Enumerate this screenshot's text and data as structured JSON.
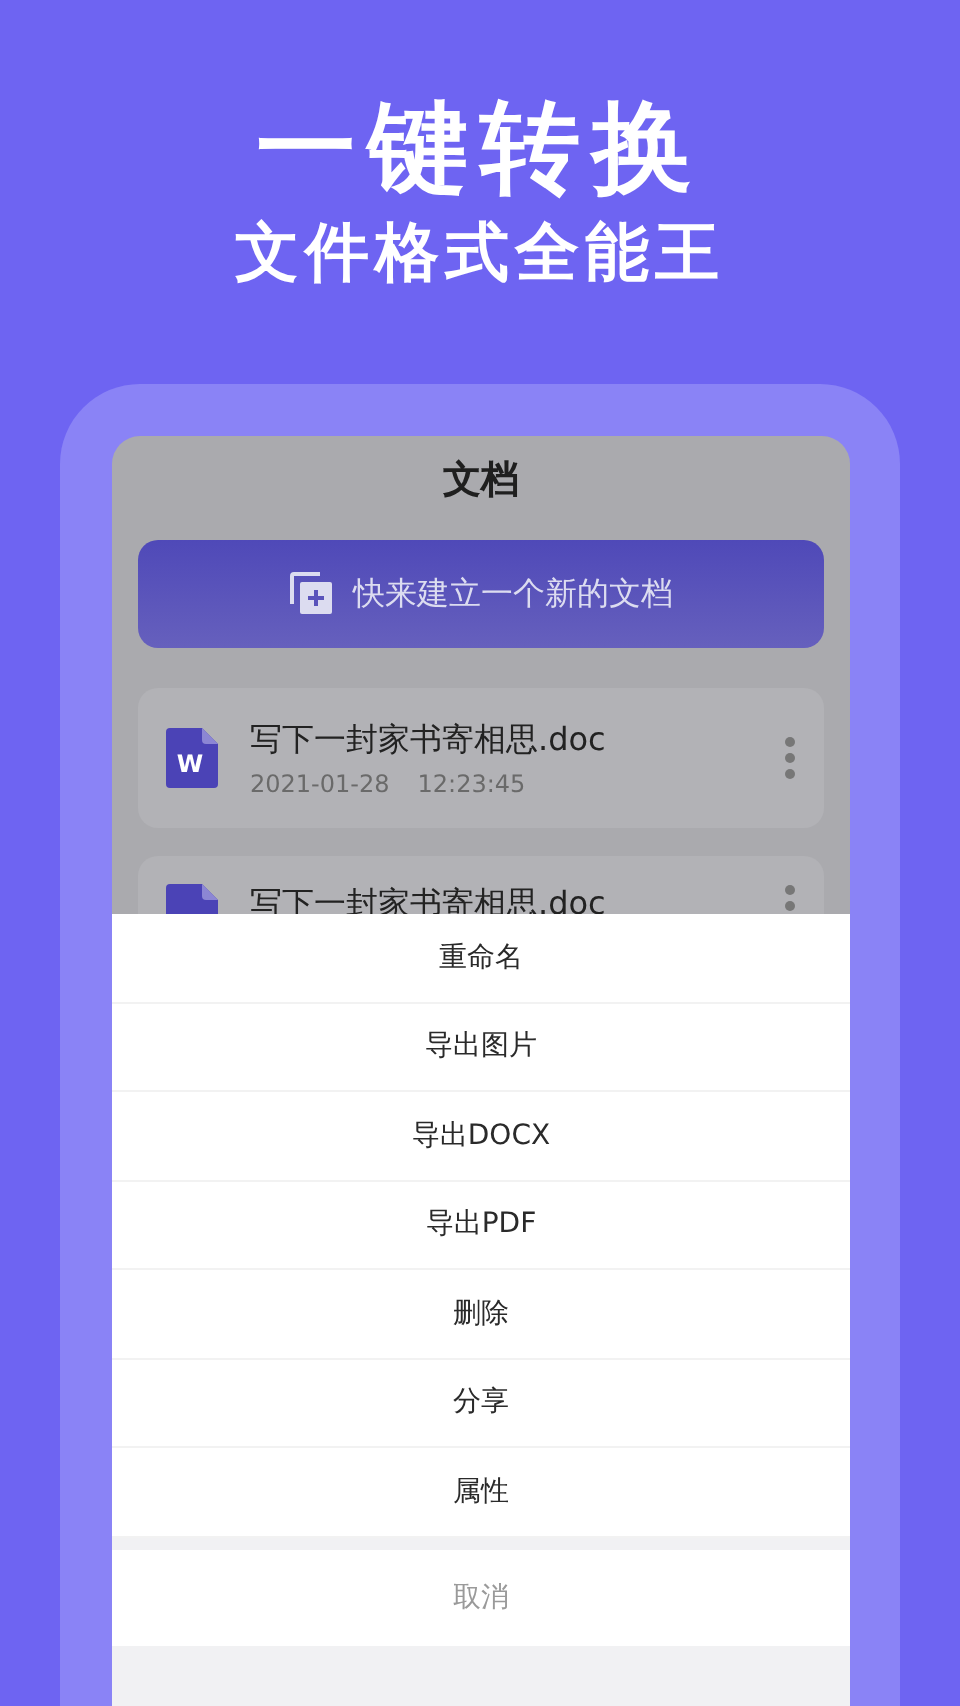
{
  "headline": "一键转换",
  "subtitle": "文件格式全能王",
  "screen": {
    "title": "文档",
    "create_button": {
      "label": "快来建立一个新的文档"
    },
    "documents": [
      {
        "name": "写下一封家书寄相思.doc",
        "date": "2021-01-28",
        "time": "12:23:45",
        "badge": "W"
      },
      {
        "name": "写下一封家书寄相思.doc"
      }
    ]
  },
  "action_sheet": {
    "items": [
      {
        "label": "重命名",
        "kind": "action"
      },
      {
        "label": "导出图片",
        "kind": "action"
      },
      {
        "label": "导出DOCX",
        "kind": "action"
      },
      {
        "label": "导出PDF",
        "kind": "action"
      },
      {
        "label": "删除",
        "kind": "action"
      },
      {
        "label": "分享",
        "kind": "action"
      },
      {
        "label": "属性",
        "kind": "action"
      },
      {
        "label": "取消",
        "kind": "cancel"
      }
    ]
  }
}
